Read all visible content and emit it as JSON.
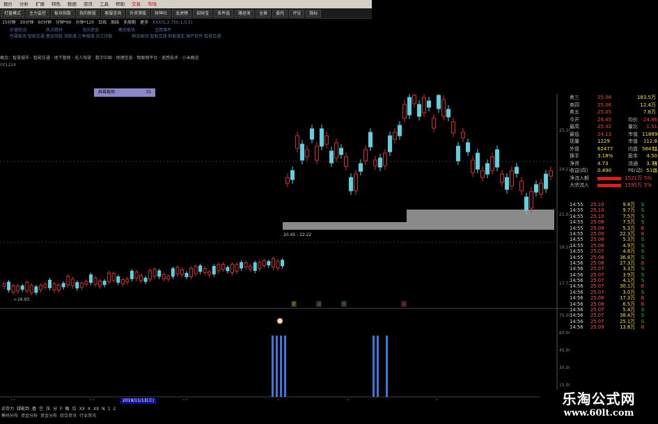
{
  "menubar": {
    "items": [
      "报价",
      "分析",
      "扩展",
      "特色",
      "数据",
      "资讯",
      "工具",
      "帮助"
    ],
    "hot": [
      "交易",
      "市场"
    ]
  },
  "toolbar": {
    "items": [
      "打盘模式",
      "主力监控",
      "板块指数",
      "我的新股",
      "客服咨询",
      "外资港股",
      "财神社",
      "龙虎榜",
      "招财宝",
      "条件选",
      "路径发",
      "全景",
      "委托",
      "评论",
      "指标"
    ]
  },
  "periodbar": {
    "items": [
      "15分钟",
      "30分钟",
      "60分钟",
      "分钟*90",
      "分钟*120",
      "日线",
      "周线",
      "多周期",
      "更多"
    ],
    "ind": "XXX(5,3,750,1,0,5)"
  },
  "infobar": {
    "row1": [
      "价值轮动",
      "热点题材",
      "北向资金",
      "概念板块",
      "主题事件"
    ],
    "row2": [
      "所属板块  智能交通 基金持股 深股通 三季报增 员工持股",
      "概念板块  智能交通 新能源车 国产软件 智慧交通"
    ]
  },
  "concepts": "概念：智慧城市 · 智能交通 · 地下管网 · 无人驾驶 · 数字中国 · 地理信息 · 物联网平台 · 遥感技术 · 小米概念",
  "code": "001224",
  "popup": {
    "label": "屏幕截图",
    "value": "35"
  },
  "chart_data": {
    "type": "candlestick",
    "y_axis_labels": [
      "25.18",
      "24.13",
      "21.03",
      "19.18",
      "17.73"
    ],
    "annotations": [
      "16.93",
      "20.95 - 22.22"
    ],
    "signals": [
      "提",
      "减",
      "跌",
      "涨"
    ],
    "lower_axis_labels": [
      "75.00",
      "60.00",
      "45.00",
      "30.00",
      "15.00"
    ],
    "x_labels": [
      "11",
      "12",
      "2019/11/13(三)",
      "13",
      "1",
      "2",
      "3"
    ]
  },
  "quote": {
    "levels": [
      {
        "name": "卖三",
        "price": "25.08",
        "vol": "183.5万"
      },
      {
        "name": "卖四",
        "price": "25.06",
        "vol": "12.4万"
      },
      {
        "name": "卖五",
        "price": "25.05",
        "vol": "7.8万"
      }
    ],
    "stats": [
      {
        "k": "今开",
        "v": "24.45",
        "k2": "均价",
        "v2": "24.86"
      },
      {
        "k": "最高",
        "v": "25.32",
        "k2": "量比",
        "v2": "1.51"
      },
      {
        "k": "最低",
        "v": "24.13",
        "k2": "市值",
        "v2": "118898"
      },
      {
        "k": "现量",
        "v": "1229",
        "k2": "市值",
        "v2": "112.8亿"
      },
      {
        "k": "外盘",
        "v": "62477",
        "k2": "内盘",
        "v2": "56471"
      },
      {
        "k": "换手",
        "v": "3.18%",
        "k2": "股本",
        "v2": "4.50亿"
      },
      {
        "k": "净资",
        "v": "4.73",
        "k2": "流通",
        "v2": "3.74亿"
      },
      {
        "k": "收益(四)",
        "v": "0.490",
        "k2": "PE(动)",
        "v2": "51.5"
      }
    ],
    "flows": [
      {
        "k": "净流入额",
        "v": "1521万",
        "p": "5%"
      },
      {
        "k": "大宗流入",
        "v": "1595万",
        "p": "5%"
      }
    ]
  },
  "ticks": [
    {
      "t": "14:55",
      "p": "25.10",
      "v": "9.8万",
      "s": "S"
    },
    {
      "t": "14:55",
      "p": "25.10",
      "v": "9.7万",
      "s": "S"
    },
    {
      "t": "14:55",
      "p": "25.10",
      "v": "7.5万",
      "s": "S"
    },
    {
      "t": "14:55",
      "p": "25.08",
      "v": "7.5万",
      "s": "S"
    },
    {
      "t": "14:55",
      "p": "25.09",
      "v": "5.3万",
      "s": "B"
    },
    {
      "t": "14:55",
      "p": "25.09",
      "v": "22.3万",
      "s": "B"
    },
    {
      "t": "14:55",
      "p": "25.08",
      "v": "5.3万",
      "s": "S"
    },
    {
      "t": "14:55",
      "p": "25.08",
      "v": "4.9万",
      "s": "S"
    },
    {
      "t": "14:55",
      "p": "25.07",
      "v": "4.8万",
      "s": "S"
    },
    {
      "t": "14:55",
      "p": "25.08",
      "v": "36.8万",
      "S": "S",
      "s": "S"
    },
    {
      "t": "14:56",
      "p": "25.08",
      "v": "27.3万",
      "s": "B"
    },
    {
      "t": "14:56",
      "p": "25.07",
      "v": "3.3万",
      "s": "S"
    },
    {
      "t": "14:56",
      "p": "25.07",
      "v": "3.9万",
      "s": "S"
    },
    {
      "t": "14:56",
      "p": "25.07",
      "v": "4.1万",
      "s": "S"
    },
    {
      "t": "14:56",
      "p": "25.07",
      "v": "30.1万",
      "s": "B"
    },
    {
      "t": "14:56",
      "p": "25.07",
      "v": "3.0万",
      "s": "S"
    },
    {
      "t": "14:56",
      "p": "25.08",
      "v": "17.3万",
      "s": "B"
    },
    {
      "t": "14:56",
      "p": "25.08",
      "v": "6.5万",
      "s": "B"
    },
    {
      "t": "14:56",
      "p": "25.07",
      "v": "5.4万",
      "s": "S"
    },
    {
      "t": "14:56",
      "p": "25.07",
      "v": "38.4万",
      "s": "S"
    },
    {
      "t": "14:56",
      "p": "25.07",
      "v": "25.1万",
      "s": "S"
    },
    {
      "t": "14:56",
      "p": "25.09",
      "v": "13.8万",
      "s": "B"
    }
  ],
  "bottom": {
    "tabs": [
      "买存力",
      "绿能到",
      "基",
      "空",
      "压",
      "分",
      "F",
      "融",
      "位",
      "XX",
      "X",
      "XX",
      "N",
      "1",
      "2"
    ],
    "tabs2": [
      "筹码分布",
      "资金分析",
      "资金分布",
      "综合资讯",
      "行业资讯"
    ],
    "date": "2019/11/13(三)"
  },
  "watermark": {
    "line1": "乐淘公式网",
    "line2": "www.60lt.com"
  }
}
